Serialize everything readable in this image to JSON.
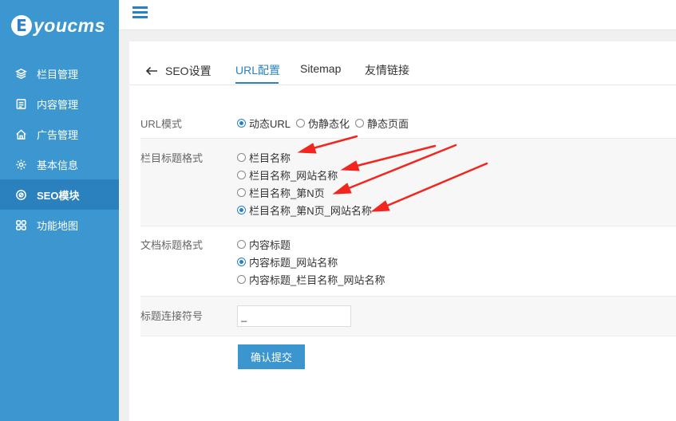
{
  "logo": {
    "letter": "E",
    "text": "youcms"
  },
  "sidebar": {
    "items": [
      {
        "label": "栏目管理",
        "icon": "layers-icon"
      },
      {
        "label": "内容管理",
        "icon": "document-icon"
      },
      {
        "label": "广告管理",
        "icon": "home-ad-icon"
      },
      {
        "label": "基本信息",
        "icon": "gear-icon"
      },
      {
        "label": "SEO模块",
        "icon": "seo-icon",
        "active": true
      },
      {
        "label": "功能地图",
        "icon": "grid-icon"
      }
    ]
  },
  "tabs": {
    "back_label": "SEO设置",
    "items": [
      "URL配置",
      "Sitemap",
      "友情链接"
    ],
    "active": "URL配置"
  },
  "form": {
    "url_mode": {
      "label": "URL模式",
      "options": [
        "动态URL",
        "伪静态化",
        "静态页面"
      ],
      "selected": "动态URL"
    },
    "column_title": {
      "label": "栏目标题格式",
      "options": [
        "栏目名称",
        "栏目名称_网站名称",
        "栏目名称_第N页",
        "栏目名称_第N页_网站名称"
      ],
      "selected": "栏目名称_第N页_网站名称"
    },
    "doc_title": {
      "label": "文档标题格式",
      "options": [
        "内容标题",
        "内容标题_网站名称",
        "内容标题_栏目名称_网站名称"
      ],
      "selected": "内容标题_网站名称"
    },
    "separator": {
      "label": "标题连接符号",
      "value": "_"
    },
    "submit_label": "确认提交"
  },
  "colors": {
    "sidebar": "#3c97d0",
    "sidebar_active": "#2a81bd",
    "accent": "#2a81bd",
    "annotation": "#f2261f"
  }
}
